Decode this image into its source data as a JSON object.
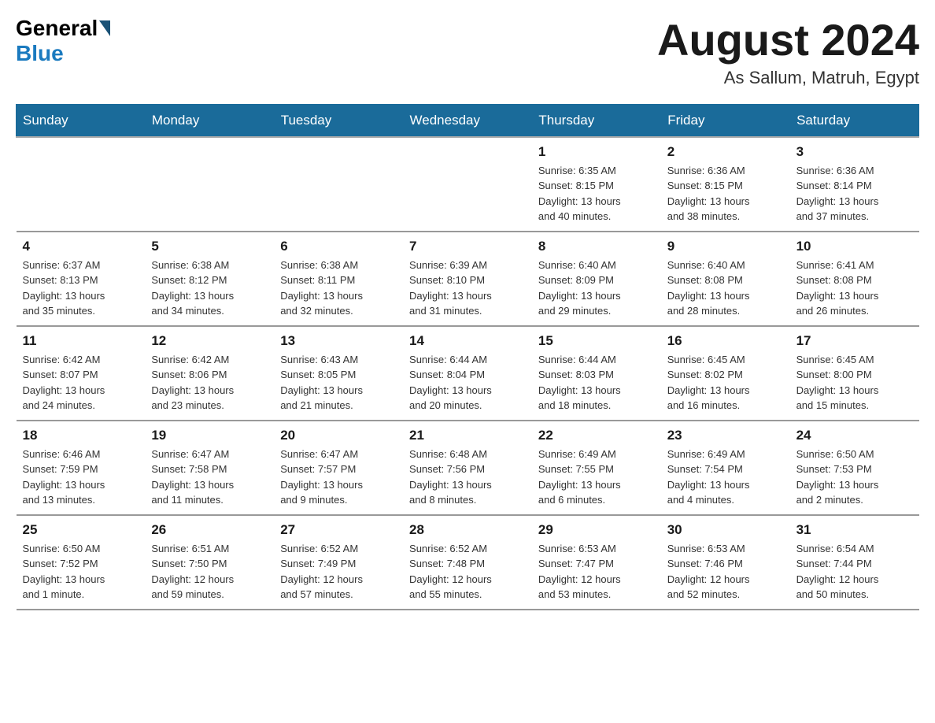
{
  "logo": {
    "text_general": "General",
    "text_blue": "Blue"
  },
  "header": {
    "month": "August 2024",
    "location": "As Sallum, Matruh, Egypt"
  },
  "weekdays": [
    "Sunday",
    "Monday",
    "Tuesday",
    "Wednesday",
    "Thursday",
    "Friday",
    "Saturday"
  ],
  "weeks": [
    [
      {
        "day": "",
        "info": ""
      },
      {
        "day": "",
        "info": ""
      },
      {
        "day": "",
        "info": ""
      },
      {
        "day": "",
        "info": ""
      },
      {
        "day": "1",
        "info": "Sunrise: 6:35 AM\nSunset: 8:15 PM\nDaylight: 13 hours\nand 40 minutes."
      },
      {
        "day": "2",
        "info": "Sunrise: 6:36 AM\nSunset: 8:15 PM\nDaylight: 13 hours\nand 38 minutes."
      },
      {
        "day": "3",
        "info": "Sunrise: 6:36 AM\nSunset: 8:14 PM\nDaylight: 13 hours\nand 37 minutes."
      }
    ],
    [
      {
        "day": "4",
        "info": "Sunrise: 6:37 AM\nSunset: 8:13 PM\nDaylight: 13 hours\nand 35 minutes."
      },
      {
        "day": "5",
        "info": "Sunrise: 6:38 AM\nSunset: 8:12 PM\nDaylight: 13 hours\nand 34 minutes."
      },
      {
        "day": "6",
        "info": "Sunrise: 6:38 AM\nSunset: 8:11 PM\nDaylight: 13 hours\nand 32 minutes."
      },
      {
        "day": "7",
        "info": "Sunrise: 6:39 AM\nSunset: 8:10 PM\nDaylight: 13 hours\nand 31 minutes."
      },
      {
        "day": "8",
        "info": "Sunrise: 6:40 AM\nSunset: 8:09 PM\nDaylight: 13 hours\nand 29 minutes."
      },
      {
        "day": "9",
        "info": "Sunrise: 6:40 AM\nSunset: 8:08 PM\nDaylight: 13 hours\nand 28 minutes."
      },
      {
        "day": "10",
        "info": "Sunrise: 6:41 AM\nSunset: 8:08 PM\nDaylight: 13 hours\nand 26 minutes."
      }
    ],
    [
      {
        "day": "11",
        "info": "Sunrise: 6:42 AM\nSunset: 8:07 PM\nDaylight: 13 hours\nand 24 minutes."
      },
      {
        "day": "12",
        "info": "Sunrise: 6:42 AM\nSunset: 8:06 PM\nDaylight: 13 hours\nand 23 minutes."
      },
      {
        "day": "13",
        "info": "Sunrise: 6:43 AM\nSunset: 8:05 PM\nDaylight: 13 hours\nand 21 minutes."
      },
      {
        "day": "14",
        "info": "Sunrise: 6:44 AM\nSunset: 8:04 PM\nDaylight: 13 hours\nand 20 minutes."
      },
      {
        "day": "15",
        "info": "Sunrise: 6:44 AM\nSunset: 8:03 PM\nDaylight: 13 hours\nand 18 minutes."
      },
      {
        "day": "16",
        "info": "Sunrise: 6:45 AM\nSunset: 8:02 PM\nDaylight: 13 hours\nand 16 minutes."
      },
      {
        "day": "17",
        "info": "Sunrise: 6:45 AM\nSunset: 8:00 PM\nDaylight: 13 hours\nand 15 minutes."
      }
    ],
    [
      {
        "day": "18",
        "info": "Sunrise: 6:46 AM\nSunset: 7:59 PM\nDaylight: 13 hours\nand 13 minutes."
      },
      {
        "day": "19",
        "info": "Sunrise: 6:47 AM\nSunset: 7:58 PM\nDaylight: 13 hours\nand 11 minutes."
      },
      {
        "day": "20",
        "info": "Sunrise: 6:47 AM\nSunset: 7:57 PM\nDaylight: 13 hours\nand 9 minutes."
      },
      {
        "day": "21",
        "info": "Sunrise: 6:48 AM\nSunset: 7:56 PM\nDaylight: 13 hours\nand 8 minutes."
      },
      {
        "day": "22",
        "info": "Sunrise: 6:49 AM\nSunset: 7:55 PM\nDaylight: 13 hours\nand 6 minutes."
      },
      {
        "day": "23",
        "info": "Sunrise: 6:49 AM\nSunset: 7:54 PM\nDaylight: 13 hours\nand 4 minutes."
      },
      {
        "day": "24",
        "info": "Sunrise: 6:50 AM\nSunset: 7:53 PM\nDaylight: 13 hours\nand 2 minutes."
      }
    ],
    [
      {
        "day": "25",
        "info": "Sunrise: 6:50 AM\nSunset: 7:52 PM\nDaylight: 13 hours\nand 1 minute."
      },
      {
        "day": "26",
        "info": "Sunrise: 6:51 AM\nSunset: 7:50 PM\nDaylight: 12 hours\nand 59 minutes."
      },
      {
        "day": "27",
        "info": "Sunrise: 6:52 AM\nSunset: 7:49 PM\nDaylight: 12 hours\nand 57 minutes."
      },
      {
        "day": "28",
        "info": "Sunrise: 6:52 AM\nSunset: 7:48 PM\nDaylight: 12 hours\nand 55 minutes."
      },
      {
        "day": "29",
        "info": "Sunrise: 6:53 AM\nSunset: 7:47 PM\nDaylight: 12 hours\nand 53 minutes."
      },
      {
        "day": "30",
        "info": "Sunrise: 6:53 AM\nSunset: 7:46 PM\nDaylight: 12 hours\nand 52 minutes."
      },
      {
        "day": "31",
        "info": "Sunrise: 6:54 AM\nSunset: 7:44 PM\nDaylight: 12 hours\nand 50 minutes."
      }
    ]
  ]
}
